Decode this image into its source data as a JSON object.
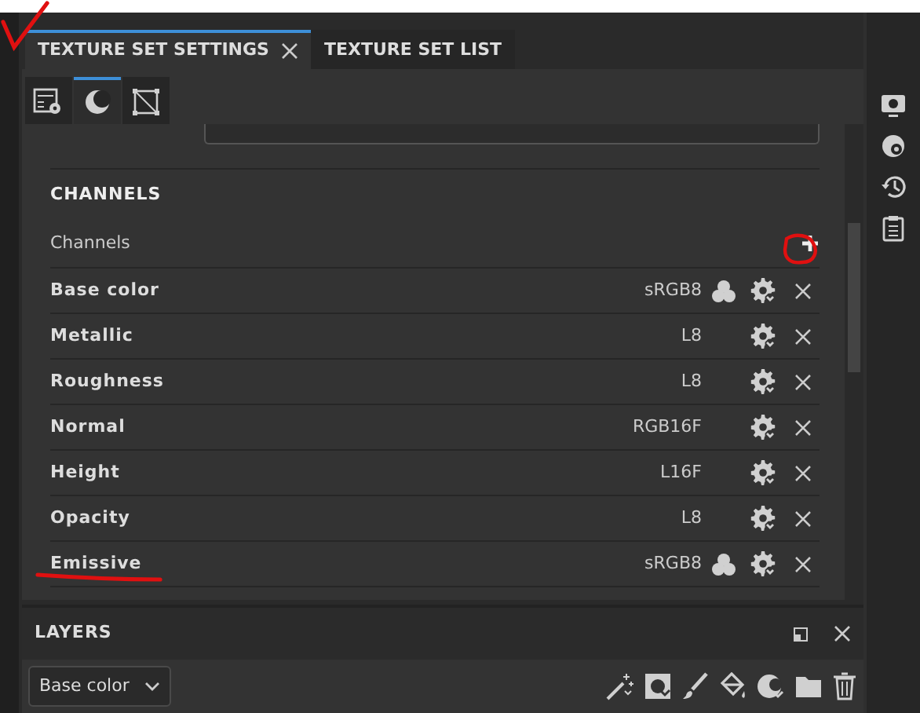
{
  "tabs": [
    {
      "label": "TEXTURE SET SETTINGS",
      "selected": true
    },
    {
      "label": "TEXTURE SET LIST",
      "selected": false
    }
  ],
  "view_tabs": [
    {
      "kind": "settings",
      "selected": false
    },
    {
      "kind": "shader",
      "selected": true
    },
    {
      "kind": "uv",
      "selected": false
    }
  ],
  "section_title": "CHANNELS",
  "channels_label": "Channels",
  "channels": [
    {
      "name": "Base color",
      "format": "sRGB8",
      "blend_icon": true
    },
    {
      "name": "Metallic",
      "format": "L8",
      "blend_icon": false
    },
    {
      "name": "Roughness",
      "format": "L8",
      "blend_icon": false
    },
    {
      "name": "Normal",
      "format": "RGB16F",
      "blend_icon": false
    },
    {
      "name": "Height",
      "format": "L16F",
      "blend_icon": false
    },
    {
      "name": "Opacity",
      "format": "L8",
      "blend_icon": false
    },
    {
      "name": "Emissive",
      "format": "sRGB8",
      "blend_icon": true
    }
  ],
  "layers": {
    "title": "LAYERS",
    "channel_select": "Base color"
  },
  "sidebar": [
    {
      "kind": "display"
    },
    {
      "kind": "bake"
    },
    {
      "kind": "history"
    },
    {
      "kind": "notes"
    }
  ],
  "layer_tools": [
    {
      "kind": "wand"
    },
    {
      "kind": "fill-layer"
    },
    {
      "kind": "brush"
    },
    {
      "kind": "bucket"
    },
    {
      "kind": "mask"
    },
    {
      "kind": "folder"
    },
    {
      "kind": "trash"
    }
  ]
}
